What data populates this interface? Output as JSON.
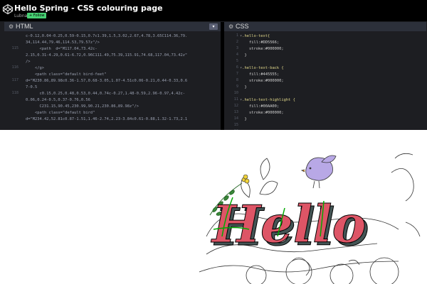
{
  "header": {
    "title": "Hello Spring - CSS colouring page",
    "author": "Lubna",
    "follow_label": "+ Follow"
  },
  "editors": {
    "html": {
      "label": "HTML",
      "line_numbers": [
        "",
        "",
        "115",
        "",
        "",
        "116",
        "",
        "117",
        "",
        "118",
        "",
        ""
      ],
      "lines": [
        "c-0.12,0.04-0.25,0.59-0.15,0.7c1.39,1.5,3.02,2.67,4.78,3.65C114.36,79.",
        "34,114.44,79.46,114.53,79.57z\"/>",
        "      <path  d=\"M117.04,73.42c-",
        "2.15,0.31-4.29,0.61-6.72,0.96C111.49,75.39,115.91,74.68,117.04,73.42z\"",
        "/>",
        "    </g>",
        "    <path class=\"default bird-feet\"",
        "d=\"M230.86,89.98c0.36-1.57,0.68-3.05,1.07-4.51c0.06-0.21,0.44-0.33,0.6",
        "7-0.5",
        "      c0.15,0.25,0.48,0.53,0.44,0.74c-0.27,1.48-0.59,2.96-0.97,4.42c-",
        "0.06,0.24-0.5,0.37-0.76,0.56",
        "      C231.15,90.45,230.99,90.21,230.86,89.98z\"/>",
        "    <path class=\"default bird\"",
        "d=\"M234.42,52.81c0.87-1.51,1.46-2.74,2.23-3.84c0.61-0.88,1.32-1.73,2.1"
      ]
    },
    "css": {
      "label": "CSS",
      "line_numbers": [
        "1",
        "2",
        "3",
        "4",
        "5",
        "6",
        "7",
        "8",
        "9",
        "10",
        "11",
        "12",
        "13",
        "14",
        "15",
        "16"
      ],
      "rules": [
        {
          "selector": ".hello-text{",
          "props": [
            "fill:#DD5566;",
            "stroke:#000000;"
          ]
        },
        {
          "selector": ".hello-text-back {",
          "props": [
            "fill:#445555;",
            "stroke:#000000;"
          ]
        },
        {
          "selector": ".hello-text-highlight {",
          "props": [
            "fill:#00AA00;",
            "stroke:#000000;"
          ]
        }
      ],
      "close": "}"
    }
  },
  "preview": {
    "artwork_text": "Hello",
    "colors": {
      "hello_fill": "#DD5566",
      "hello_back": "#445555",
      "hello_highlight": "#00AA00",
      "bird": "#b8a8e6",
      "leaf": "#3a8a3a",
      "flower": "#f0d23a"
    }
  },
  "icons": {
    "logo": "codepen-logo-icon",
    "settings": "gear-icon",
    "dropdown": "chevron-down-icon"
  }
}
